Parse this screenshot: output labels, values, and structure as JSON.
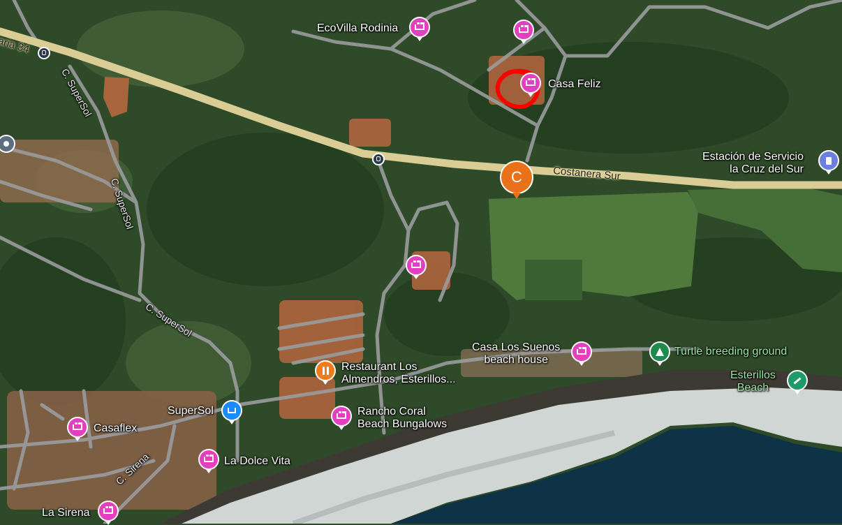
{
  "map": {
    "roads": {
      "ruta_label": "aria 34",
      "supersol_1": "C. SuperSol",
      "supersol_2": "C. SuperSol",
      "supersol_3": "C. SuperSol",
      "sirena": "C. Sirena",
      "costanera": "Costanera Sur"
    },
    "places": {
      "ecovilla": "EcoVilla Rodinia",
      "casa_feliz": "Casa Feliz",
      "estacion_line1": "Estación de Servicio",
      "estacion_line2": "la Cruz del Sur",
      "casa_suenos_line1": "Casa Los Suenos",
      "casa_suenos_line2": "beach house",
      "turtle": "Turtle breeding ground",
      "esterillos_line1": "Esterillos",
      "esterillos_line2": "Beach",
      "restaurant_line1": "Restaurant Los",
      "restaurant_line2": "Almendros, Esterillos...",
      "supersol": "SuperSol",
      "rancho_line1": "Rancho Coral",
      "rancho_line2": "Beach Bungalows",
      "casaflex": "Casaflex",
      "dolce_vita": "La Dolce Vita",
      "la_sirena": "La Sirena"
    },
    "marker_letter": "C",
    "colors": {
      "hotel": "#e33fbf",
      "food": "#ef7b1c",
      "shop": "#1a8cff",
      "park": "#1f8a4d",
      "highway": "#e6d9a2",
      "annotation": "#ff0000"
    }
  }
}
